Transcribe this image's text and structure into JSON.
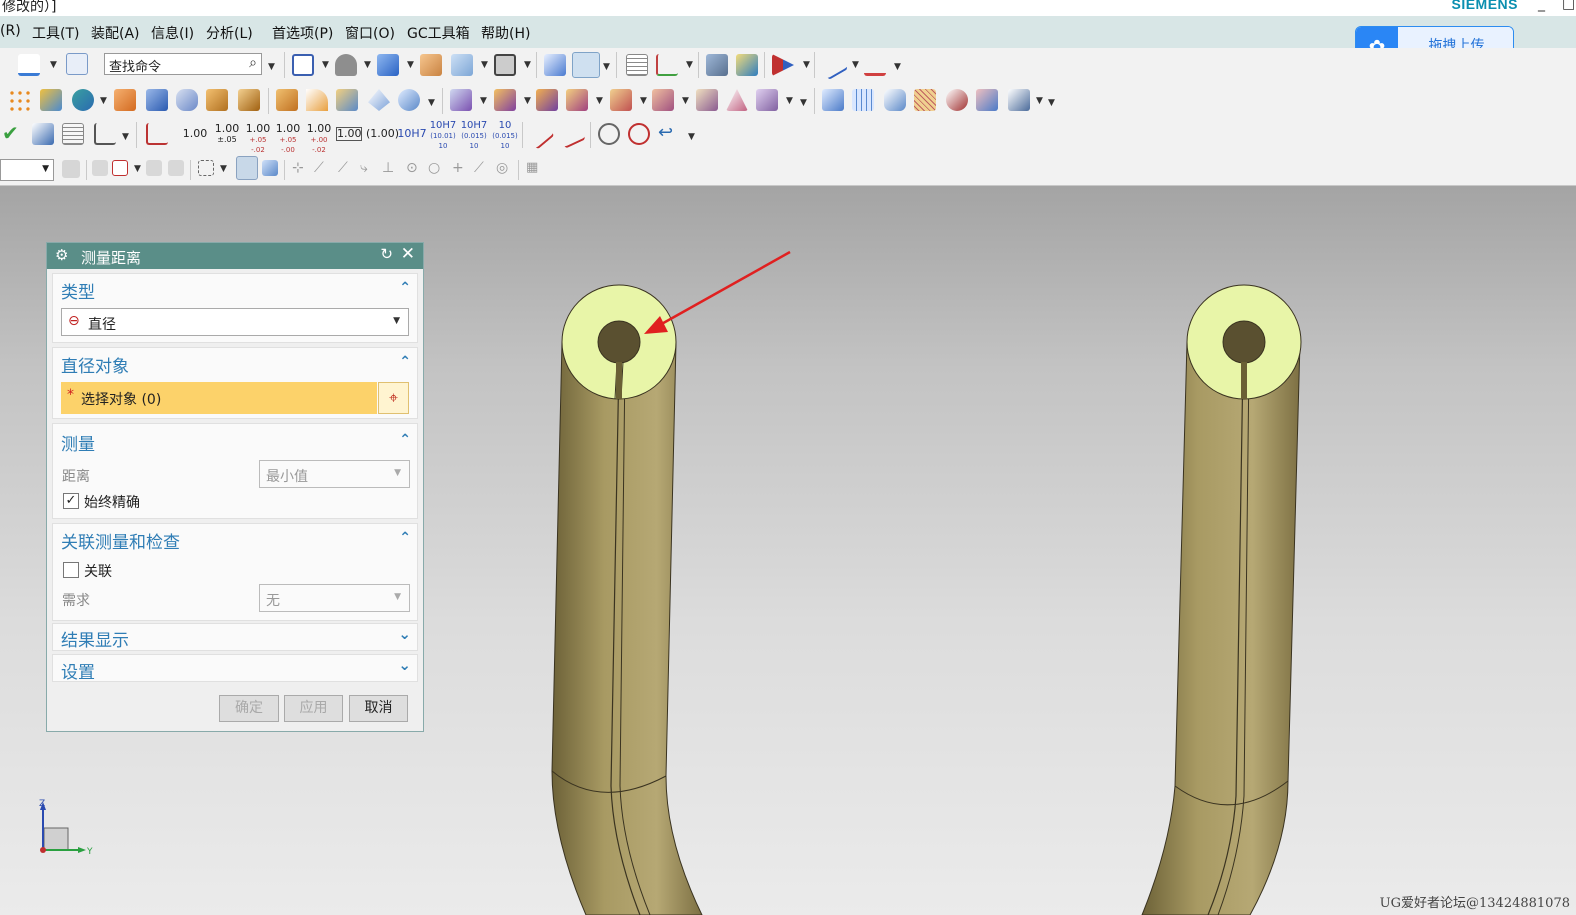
{
  "titlebar": {
    "title": "修改的）]",
    "brand": "SIEMENS",
    "min": "_",
    "max": "□"
  },
  "menu": [
    "(R)",
    "工具(T)",
    "装配(A)",
    "信息(I)",
    "分析(L)",
    "首选项(P)",
    "窗口(O)",
    "GC工具箱",
    "帮助(H)"
  ],
  "search": {
    "placeholder": "查找命令"
  },
  "upload": {
    "label": "拖拽上传"
  },
  "dimensions": [
    "1.00",
    "1.00",
    "1.00",
    "1.00",
    "1.00",
    "1.00",
    "(1.00)",
    "10H7",
    "10H7",
    "10H7",
    "10"
  ],
  "dimension_subs": [
    "",
    "±.05",
    "+.05 -.02",
    "+.05 -.00",
    "+.00 -.02",
    "",
    "",
    "",
    "(10.01) 10",
    "(0.015) 10",
    "(0.015) 10"
  ],
  "dialog": {
    "title": "测量距离",
    "type": {
      "header": "类型",
      "value": "直径"
    },
    "object": {
      "header": "直径对象",
      "select_label": "选择对象 (0)",
      "required_mark": "*"
    },
    "measure": {
      "header": "测量",
      "distance_label": "距离",
      "distance_value": "最小值",
      "always_exact_label": "始终精确",
      "always_exact_checked": true
    },
    "assoc": {
      "header": "关联测量和检查",
      "assoc_label": "关联",
      "assoc_checked": false,
      "req_label": "需求",
      "req_value": "无"
    },
    "results": {
      "header": "结果显示"
    },
    "settings": {
      "header": "设置"
    },
    "buttons": {
      "ok": "确定",
      "apply": "应用",
      "cancel": "取消"
    }
  },
  "triad": {
    "z": "Z",
    "y": "Y"
  },
  "watermark": "UG爱好者论坛@13424881078",
  "colors": {
    "menubar": "#d8e6e6",
    "dialog_title": "#5a8e88",
    "selection_highlight": "#fcd26a",
    "part_body": "#a89a63",
    "part_face": "#e8f5a8",
    "arrow": "#e02020",
    "accent": "#2f7db5"
  }
}
